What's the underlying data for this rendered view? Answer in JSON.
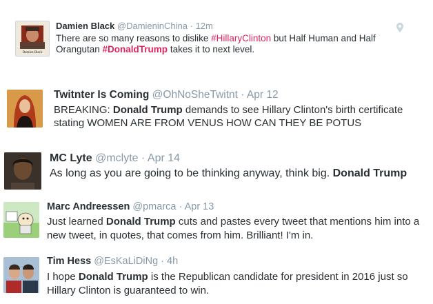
{
  "tweets": [
    {
      "name": "Damien Black",
      "handle": "@DamieninChina",
      "time": "12m",
      "avatar_icon": "avatar-photo-damien-black",
      "location_icon": "map-pin-icon",
      "text": {
        "p1": "There are so many reasons to dislike ",
        "h1": "#HillaryClinton",
        "p2": " but Half Human and Half Orangutan ",
        "h2": "#DonaldTrump",
        "p3": " takes it to next level."
      },
      "avatar_caption": "Damien Black"
    },
    {
      "name": "Twitnter Is Coming",
      "handle": "@OhNoSheTwitnt",
      "time": "Apr 12",
      "text": {
        "p1": "BREAKING: ",
        "b1": "Donald Trump",
        "p2": " demands to see Hillary Clinton's birth certificate stating WOMEN ARE FROM VENUS HOW CAN THEY BE POTUS"
      }
    },
    {
      "name": "MC Lyte",
      "handle": "@mclyte",
      "time": "Apr 14",
      "text": {
        "p1": "As long as you are going to be thinking anyway, think big. ",
        "b1": "Donald Trump"
      }
    },
    {
      "name": "Marc Andreessen",
      "handle": "@pmarca",
      "time": "Apr 13",
      "text": {
        "p1": "Just learned ",
        "b1": "Donald Trump",
        "p2": " cuts and pastes every tweet that mentions him into a new tweet, in quotes, that comes from him. Brilliant! I'm in."
      }
    },
    {
      "name": "Tim Hess",
      "handle": "@EsKaLiDiNg",
      "time": "4h",
      "text": {
        "p1": "I hope ",
        "b1": "Donald Trump",
        "p2": " is the Republican candidate for president in 2016 just so Hillary Clinton is guaranteed to win."
      }
    }
  ],
  "separator": "·",
  "colors": {
    "hashtag": "#e0245e",
    "meta": "#8899a6",
    "text": "#292f33"
  }
}
